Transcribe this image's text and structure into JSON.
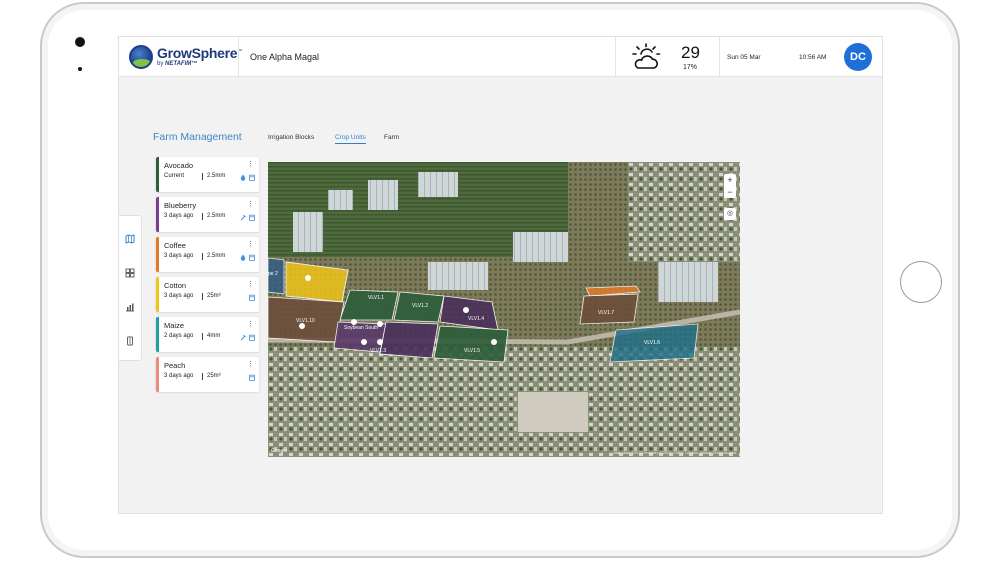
{
  "app": {
    "brand_name": "GrowSphere",
    "brand_tm": "™",
    "brand_by": "by",
    "brand_partner": "NETAFIM™"
  },
  "header": {
    "farm_name": "One Alpha Magal",
    "weather_icon": "partly-cloudy-sun-icon",
    "temperature": "29",
    "humidity": "17%",
    "date": "Sun 05 Mar",
    "time": "10:56 AM",
    "user_initials": "DC"
  },
  "side_nav": {
    "items": [
      "map-icon",
      "crop-units-icon",
      "reports-icon",
      "equipment-icon"
    ]
  },
  "main": {
    "title": "Farm Management",
    "tabs": [
      {
        "label": "Irrigation Blocks",
        "active": false
      },
      {
        "label": "Crop Units",
        "active": true
      },
      {
        "label": "Farm",
        "active": false
      }
    ]
  },
  "crop_units": [
    {
      "name": "Avocado",
      "when": "Current",
      "amount": "2.5mm",
      "color": "#2e5e3a",
      "icons": [
        "drop-icon",
        "calendar-icon"
      ]
    },
    {
      "name": "Blueberry",
      "when": "3 days ago",
      "amount": "2.5mm",
      "color": "#7a3f8f",
      "icons": [
        "fertilizer-icon",
        "calendar-icon"
      ]
    },
    {
      "name": "Coffee",
      "when": "3 days ago",
      "amount": "2.5mm",
      "color": "#e07a2a",
      "icons": [
        "drop-icon",
        "calendar-icon"
      ]
    },
    {
      "name": "Cotton",
      "when": "3 days ago",
      "amount": "25m³",
      "color": "#f0c419",
      "icons": [
        "calendar-icon"
      ]
    },
    {
      "name": "Maize",
      "when": "2 days ago",
      "amount": "4mm",
      "color": "#1fa0a0",
      "icons": [
        "fertilizer-icon",
        "calendar-icon"
      ]
    },
    {
      "name": "Peach",
      "when": "3 days ago",
      "amount": "25m³",
      "color": "#f08a7a",
      "icons": [
        "calendar-icon"
      ]
    }
  ],
  "map": {
    "labels": {
      "vlv1_1": "VLV1.1",
      "vlv1_2": "VLV1.2",
      "vlv1_3": "VLV1.3",
      "vlv1_4": "VLV1.4",
      "vlv1_5": "VLV1.5",
      "vlv1_6": "VLV1.6",
      "vlv1_7": "VLV1.7",
      "vlv1_10": "VLV1.10",
      "soybean_south": "Soybean South",
      "pe2": "pe 2"
    },
    "zoom_in": "+",
    "zoom_out": "−",
    "attribution": "Map data ©2023 Imagery ©2023 CNES / Airbus, Maxar Technologies",
    "logo": "Google"
  }
}
